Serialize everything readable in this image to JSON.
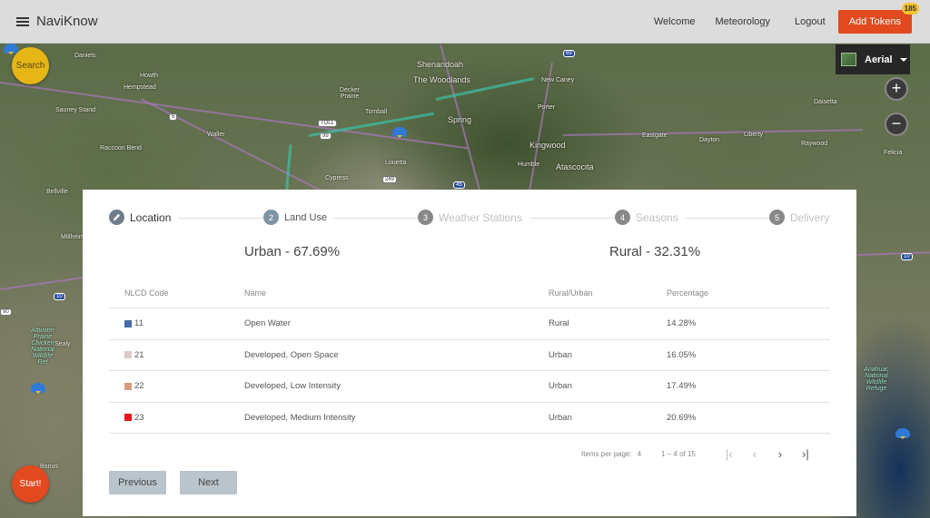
{
  "app": {
    "brand": "NaviKnow"
  },
  "nav": {
    "welcome": "Welcome",
    "meteorology": "Meteorology",
    "logout": "Logout",
    "add_tokens": "Add Tokens",
    "token_count": "185"
  },
  "map": {
    "layer_label": "Aerial",
    "search_label": "Search",
    "start_label": "Start!",
    "zoom_in": "+",
    "zoom_out": "−",
    "labels": {
      "daniels": "Daniels",
      "howth": "Howth",
      "hempstead": "Hempstead",
      "sauney_stand": "Sauney Stand",
      "waller": "Waller",
      "raccoon_bend": "Raccoon Bend",
      "bellville": "Bellville",
      "millheim": "Millheim",
      "decker_prairie": "Decker Prairie",
      "tomball": "Tomball",
      "shenandoah": "Shenandoah",
      "the_woodlands": "The Woodlands",
      "spring": "Spring",
      "new_caney": "New Caney",
      "porter": "Porter",
      "kingwood": "Kingwood",
      "humble": "Humble",
      "atascocita": "Atascocita",
      "louetta": "Louetta",
      "cypress": "Cypress",
      "dayton": "Dayton",
      "liberty": "Liberty",
      "raywood": "Raywood",
      "daisetta": "Daisetta",
      "felicia": "Felicia",
      "eastgate": "Eastgate",
      "attwater": "Attwater Prairie Chicken National Wildlife Ref",
      "sealy": "Sealy",
      "anahuac": "Anahuac National Wildlife Refuge",
      "bonus": "Bonus",
      "toll": "TOLL"
    },
    "shields": {
      "i69": "69",
      "us6": "6",
      "sh99": "99",
      "sh249": "249",
      "i10_left": "10",
      "i10_right": "10",
      "i10_edge": "90",
      "i45": "45"
    }
  },
  "wizard": {
    "steps": [
      {
        "num": "",
        "label": "Location"
      },
      {
        "num": "2",
        "label": "Land Use"
      },
      {
        "num": "3",
        "label": "Weather Stations"
      },
      {
        "num": "4",
        "label": "Seasons"
      },
      {
        "num": "5",
        "label": "Delivery"
      }
    ],
    "urban_summary": "Urban - 67.69%",
    "rural_summary": "Rural - 32.31%",
    "table": {
      "headers": [
        "NLCD Code",
        "Name",
        "Rural/Urban",
        "Percentage"
      ],
      "rows": [
        {
          "code": "11",
          "color": "#466ba8",
          "name": "Open Water",
          "type": "Rural",
          "pct": "14.28%"
        },
        {
          "code": "21",
          "color": "#dccbc4",
          "name": "Developed, Open Space",
          "type": "Urban",
          "pct": "16.05%"
        },
        {
          "code": "22",
          "color": "#d89b82",
          "name": "Developed, Low Intensity",
          "type": "Urban",
          "pct": "17.49%"
        },
        {
          "code": "23",
          "color": "#e8131b",
          "name": "Developed, Medium Intensity",
          "type": "Urban",
          "pct": "20.69%"
        }
      ]
    },
    "pager": {
      "items_per_page_label": "Items per page:",
      "items_per_page": "4",
      "range": "1 – 4 of 15"
    },
    "previous": "Previous",
    "next": "Next"
  }
}
